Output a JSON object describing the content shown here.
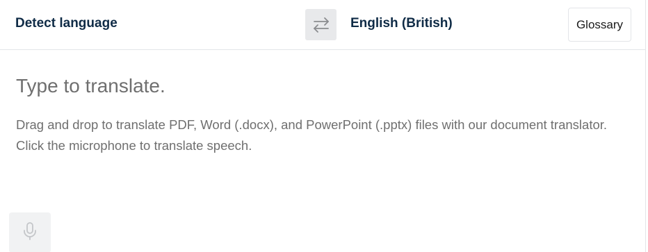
{
  "header": {
    "source_language": "Detect language",
    "target_language": "English (British)",
    "glossary_label": "Glossary",
    "swap_icon": "swap-arrows-icon"
  },
  "editor": {
    "placeholder": "Type to translate.",
    "hint_line1": "Drag and drop to translate PDF, Word (.docx), and PowerPoint (.pptx) files with our document translator.",
    "hint_line2": "Click the microphone to translate speech.",
    "mic_icon": "microphone-icon"
  },
  "colors": {
    "language_text": "#0f2b46",
    "placeholder_text": "#6f6f6f",
    "swap_button_bg": "#e8e9eb",
    "mic_button_bg": "#f1f2f3",
    "divider": "#e3e5e8"
  }
}
